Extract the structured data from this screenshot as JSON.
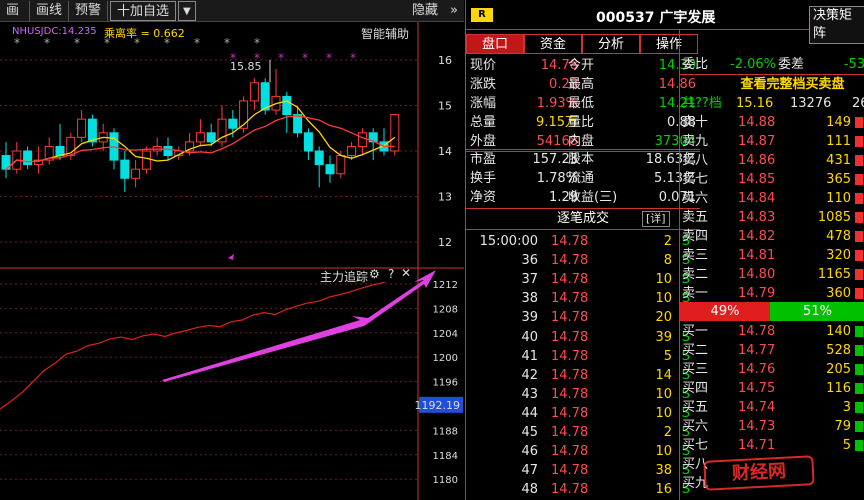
{
  "toolbar": {
    "items": [
      "画面",
      "画线",
      "预警",
      "十加自选"
    ],
    "hide_label": "隐藏",
    "chevron": "»",
    "dropdown": "▼"
  },
  "chart": {
    "indicators": {
      "ma_label": "NHUSJDC:14.235",
      "ma_value_label": "乘离率 = 0.662",
      "assist_label": "智能辅助"
    },
    "price_axis": [
      "16",
      "15",
      "14",
      "13",
      "12"
    ],
    "peak_label": "15.85",
    "lower_title": "主力追踪",
    "lower_icons": [
      "gear-icon",
      "help-icon",
      "close-icon"
    ],
    "lower_axis": [
      "1212",
      "1208",
      "1204",
      "1200",
      "1196",
      "1192.19",
      "1188",
      "1184",
      "1180"
    ],
    "candles": [
      [
        13.9,
        13.6,
        14.2,
        13.4
      ],
      [
        13.6,
        14.0,
        14.2,
        13.5
      ],
      [
        14.0,
        13.7,
        14.1,
        13.6
      ],
      [
        13.7,
        13.8,
        14.1,
        13.5
      ],
      [
        13.8,
        14.1,
        14.3,
        13.7
      ],
      [
        14.1,
        13.9,
        14.6,
        13.8
      ],
      [
        13.9,
        14.3,
        14.4,
        13.8
      ],
      [
        14.3,
        14.7,
        14.9,
        14.2
      ],
      [
        14.7,
        14.2,
        14.8,
        14.1
      ],
      [
        14.2,
        14.4,
        14.6,
        14.0
      ],
      [
        14.4,
        13.8,
        14.5,
        13.6
      ],
      [
        13.8,
        13.4,
        14.0,
        13.1
      ],
      [
        13.4,
        13.6,
        13.8,
        13.2
      ],
      [
        13.6,
        14.0,
        14.1,
        13.5
      ],
      [
        14.0,
        14.1,
        14.3,
        13.9
      ],
      [
        14.1,
        13.9,
        14.3,
        13.8
      ],
      [
        13.9,
        14.0,
        14.1,
        13.8
      ],
      [
        14.0,
        14.2,
        14.4,
        13.9
      ],
      [
        14.2,
        14.4,
        14.7,
        14.1
      ],
      [
        14.4,
        14.2,
        14.6,
        14.1
      ],
      [
        14.2,
        14.7,
        15.0,
        14.1
      ],
      [
        14.7,
        14.5,
        14.9,
        14.3
      ],
      [
        14.5,
        15.1,
        15.2,
        14.4
      ],
      [
        15.1,
        15.5,
        15.6,
        14.9
      ],
      [
        15.5,
        14.9,
        15.6,
        14.8
      ],
      [
        14.9,
        15.2,
        15.8,
        14.8
      ],
      [
        15.2,
        14.8,
        15.3,
        14.4
      ],
      [
        14.8,
        14.4,
        15.0,
        14.3
      ],
      [
        14.4,
        14.0,
        14.5,
        13.8
      ],
      [
        14.0,
        13.7,
        14.1,
        13.2
      ],
      [
        13.7,
        13.5,
        13.9,
        13.3
      ],
      [
        13.5,
        13.9,
        14.0,
        13.4
      ],
      [
        13.9,
        14.1,
        14.2,
        13.8
      ],
      [
        14.1,
        14.4,
        14.5,
        13.9
      ],
      [
        14.4,
        14.2,
        14.5,
        13.8
      ],
      [
        14.2,
        14.0,
        14.5,
        13.9
      ],
      [
        14.0,
        14.8,
        14.8,
        13.9
      ]
    ],
    "lower_series": [
      1191.5,
      1192.8,
      1194.2,
      1196.0,
      1197.8,
      1199.0,
      1200.5,
      1201.0,
      1201.9,
      1202.3,
      1203.0,
      1203.3,
      1202.9,
      1203.5,
      1203.8,
      1203.4,
      1204.0,
      1204.4,
      1204.9,
      1205.2,
      1205.0,
      1205.8,
      1206.1,
      1206.9,
      1207.3,
      1207.0,
      1207.8,
      1208.4,
      1208.9,
      1209.2,
      1209.9,
      1210.3,
      1210.8,
      1211.4,
      1211.9,
      1212.3
    ]
  },
  "header": {
    "badge": "R",
    "code_name": "000537  广宇发展",
    "decision_button": "决策矩阵"
  },
  "tabs": [
    "盘口",
    "资金",
    "分析",
    "操作"
  ],
  "quote": [
    {
      "l": "现价",
      "v": "14.78",
      "vc": "red",
      "l2": "今开",
      "v2": "14.30",
      "v2c": "green"
    },
    {
      "l": "涨跌",
      "v": "0.28",
      "vc": "red",
      "l2": "最高",
      "v2": "14.86",
      "v2c": "red"
    },
    {
      "l": "涨幅",
      "v": "1.93%",
      "vc": "red",
      "l2": "最低",
      "v2": "14.21",
      "v2c": "green"
    },
    {
      "l": "总量",
      "v": "9.15万",
      "vc": "yellow",
      "l2": "量比",
      "v2": "0.88",
      "v2c": "white"
    },
    {
      "l": "外盘",
      "v": "54168",
      "vc": "red",
      "l2": "内盘",
      "v2": "37304",
      "v2c": "green"
    },
    {
      "l": "市盈",
      "v": "157.23",
      "vc": "white",
      "l2": "股本",
      "v2": "18.63亿",
      "v2c": "white"
    },
    {
      "l": "换手",
      "v": "1.78%",
      "vc": "white",
      "l2": "流通",
      "v2": "5.13亿",
      "v2c": "white"
    },
    {
      "l": "净资",
      "v": "1.29",
      "vc": "white",
      "l2": "收益(三)",
      "v2": "0.071",
      "v2c": "white"
    }
  ],
  "trades_title": "逐笔成交",
  "trades_detail": "[详]",
  "trades": [
    [
      "15:00:00",
      "14.78",
      "2",
      "S"
    ],
    [
      "36",
      "14.78",
      "8",
      "S"
    ],
    [
      "37",
      "14.78",
      "10",
      "S"
    ],
    [
      "38",
      "14.78",
      "10",
      "S"
    ],
    [
      "39",
      "14.78",
      "20",
      "S"
    ],
    [
      "40",
      "14.78",
      "39",
      "S"
    ],
    [
      "41",
      "14.78",
      "5",
      "S"
    ],
    [
      "42",
      "14.78",
      "14",
      "S"
    ],
    [
      "43",
      "14.78",
      "10",
      "S"
    ],
    [
      "44",
      "14.78",
      "10",
      "S"
    ],
    [
      "45",
      "14.78",
      "2",
      "S"
    ],
    [
      "46",
      "14.78",
      "10",
      "S"
    ],
    [
      "47",
      "14.78",
      "38",
      "S"
    ],
    [
      "48",
      "14.78",
      "16",
      "S"
    ]
  ],
  "orderbook": {
    "ratio_label": "委比",
    "ratio": "-2.06%",
    "diff_label": "委差",
    "diff": "-53",
    "title": "查看完整档买卖盘",
    "total_label": "共??档",
    "total_price": "15.16",
    "total_vol": "13276",
    "total_extra": "26",
    "asks": [
      [
        "卖十",
        "14.88",
        "149"
      ],
      [
        "卖九",
        "14.87",
        "111"
      ],
      [
        "卖八",
        "14.86",
        "431"
      ],
      [
        "卖七",
        "14.85",
        "365"
      ],
      [
        "卖六",
        "14.84",
        "110"
      ],
      [
        "卖五",
        "14.83",
        "1085"
      ],
      [
        "卖四",
        "14.82",
        "478"
      ],
      [
        "卖三",
        "14.81",
        "320"
      ],
      [
        "卖二",
        "14.80",
        "1165"
      ],
      [
        "卖一",
        "14.79",
        "360"
      ]
    ],
    "sell_pct": "49%",
    "buy_pct": "51%",
    "bids": [
      [
        "买一",
        "14.78",
        "140"
      ],
      [
        "买二",
        "14.77",
        "528"
      ],
      [
        "买三",
        "14.76",
        "205"
      ],
      [
        "买四",
        "14.75",
        "116"
      ],
      [
        "买五",
        "14.74",
        "3"
      ],
      [
        "买六",
        "14.73",
        "79"
      ],
      [
        "买七",
        "14.71",
        "5"
      ],
      [
        "买八",
        "",
        ""
      ],
      [
        "买九",
        "",
        ""
      ]
    ]
  },
  "watermark": "财经网"
}
